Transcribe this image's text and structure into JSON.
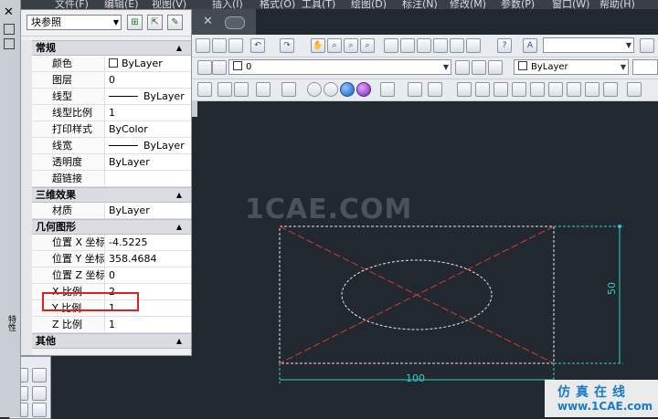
{
  "menubar": {
    "items": [
      "文件(F)",
      "编辑(E)",
      "视图(V)",
      "插入(I)",
      "格式(O)",
      "工具(T)",
      "绘图(D)",
      "标注(N)",
      "修改(M)",
      "参数(P)",
      "窗口(W)",
      "帮助(H)"
    ]
  },
  "toolbar": {
    "layer_value": "0",
    "linetype_color": "ByLayer"
  },
  "properties": {
    "selection": "块参照",
    "sections": {
      "general": "常规",
      "3d": "三维效果",
      "geometry": "几何图形",
      "misc": "其他"
    },
    "general_rows": [
      {
        "key": "颜色",
        "value": "ByLayer"
      },
      {
        "key": "图层",
        "value": "0"
      },
      {
        "key": "线型",
        "value": "ByLayer"
      },
      {
        "key": "线型比例",
        "value": "1"
      },
      {
        "key": "打印样式",
        "value": "ByColor"
      },
      {
        "key": "线宽",
        "value": "ByLayer"
      },
      {
        "key": "透明度",
        "value": "ByLayer"
      },
      {
        "key": "超链接",
        "value": ""
      }
    ],
    "threed_rows": [
      {
        "key": "材质",
        "value": "ByLayer"
      }
    ],
    "geometry_rows": [
      {
        "key": "位置 X 坐标",
        "value": "-4.5225"
      },
      {
        "key": "位置 Y 坐标",
        "value": "358.4684"
      },
      {
        "key": "位置 Z 坐标",
        "value": "0"
      },
      {
        "key": "X 比例",
        "value": "2"
      },
      {
        "key": "Y 比例",
        "value": "1"
      },
      {
        "key": "Z 比例",
        "value": "1"
      }
    ]
  },
  "left_dock": {
    "vertical_title": "特性"
  },
  "drawing": {
    "watermark": "1CAE.COM",
    "dim_width": "100",
    "dim_height": "50"
  },
  "logo": {
    "cn": "仿真在线",
    "en": "www.1CAE.com"
  },
  "colors": {
    "canvas_bg": "#212830",
    "dim_color": "#2fd0c8",
    "cross_color": "#d23a3a",
    "highlight": "#e02020"
  }
}
